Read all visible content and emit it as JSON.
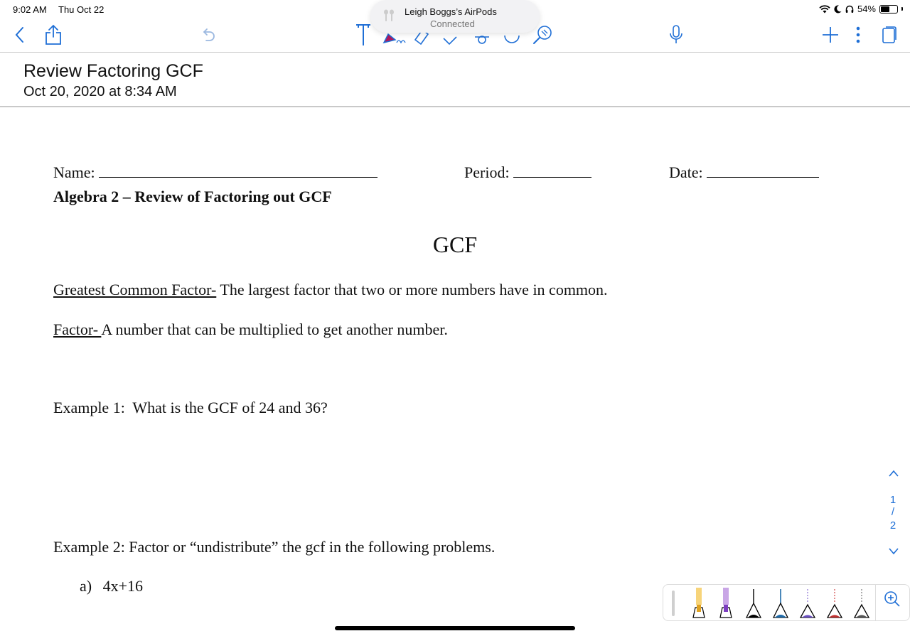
{
  "status_bar": {
    "time": "9:02 AM",
    "date": "Thu Oct 22",
    "battery": "54%",
    "battery_level": 0.54
  },
  "airpods_popup": {
    "title": "Leigh Boggs’s AirPods",
    "subtitle": "Connected"
  },
  "note": {
    "title": "Review Factoring GCF",
    "date": "Oct 20, 2020 at 8:34 AM"
  },
  "document": {
    "name_label": "Name:",
    "period_label": "Period:",
    "date_label": "Date:",
    "subtitle": "Algebra 2 – Review of Factoring out GCF",
    "heading": "GCF",
    "def1_term": "Greatest Common Factor-",
    "def1_text": " The largest factor that two or more numbers have in common.",
    "def2_term": "Factor- ",
    "def2_text": "A number that can be multiplied to get another number.",
    "example1": "Example 1:  What is the GCF of 24 and 36?",
    "example2": "Example 2: Factor or “undistribute” the gcf in the following problems.",
    "problem_a_label": "a)",
    "problem_a_expr": "4x+16"
  },
  "pager": {
    "current": "1",
    "separator": "/",
    "total": "2"
  },
  "colors": {
    "accent": "#1f6fd6",
    "highlighter_yellow": "#f7d47a",
    "highlighter_purple": "#c9a6e6"
  }
}
